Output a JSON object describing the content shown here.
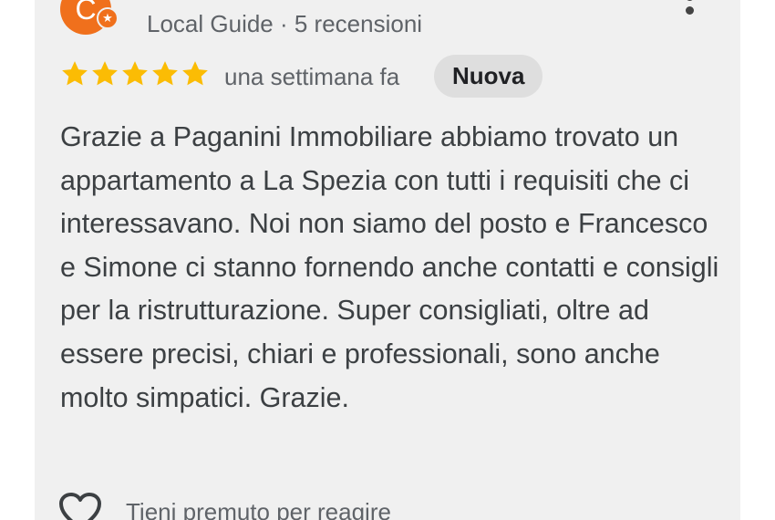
{
  "reviewer": {
    "avatar_initial": "C",
    "badge_icon": "local-guide-star-icon",
    "meta": "Local Guide · 5 recensioni"
  },
  "menu": {
    "icon": "more-vert-icon"
  },
  "rating": {
    "stars": 5,
    "max_stars": 5,
    "star_color": "#fbbc04",
    "time_ago": "una settimana fa",
    "badge": "Nuova"
  },
  "review": {
    "text": "Grazie a Paganini Immobiliare abbiamo trovato un appartamento a La Spezia con tutti i requisiti che ci interessavano. Noi non siamo del posto e Francesco e Simone ci stanno fornendo anche contatti e consigli per la ristrutturazione. Super consigliati, oltre ad essere precisi, chiari e professionali, sono anche molto simpatici. Grazie."
  },
  "reaction": {
    "icon": "heart-outline-icon",
    "label": "Tieni premuto per reagire"
  },
  "colors": {
    "avatar": "#f0701c",
    "card_background": "#f0f0f0",
    "badge_background": "#dedede"
  }
}
